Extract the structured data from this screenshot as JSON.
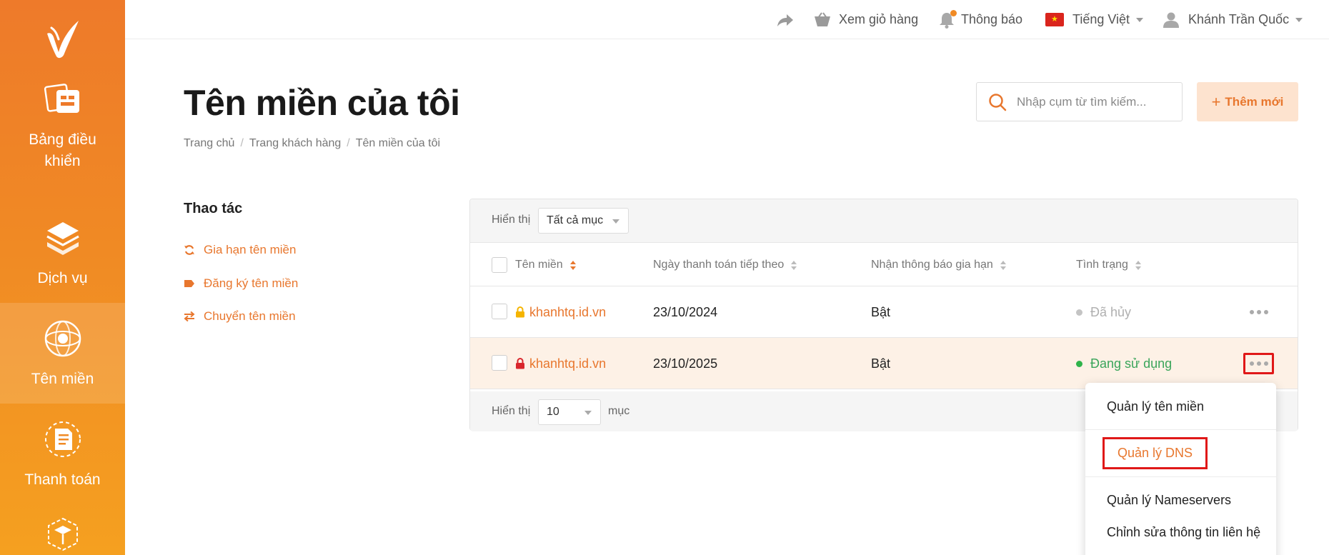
{
  "colors": {
    "brand": "#ee7a2a",
    "accent_link": "#e8772e",
    "active_status": "#3aa55a",
    "cancelled_status": "#b5b5b5",
    "highlight_box": "#e01818"
  },
  "sidebar": {
    "logo_icon": "check-logo-icon",
    "items": [
      {
        "label": "Bảng điều khiển",
        "icon": "dashboard-icon"
      },
      {
        "label": "Dịch vụ",
        "icon": "layers-icon"
      },
      {
        "label": "Tên miền",
        "icon": "globe-icon",
        "active": true
      },
      {
        "label": "Thanh toán",
        "icon": "invoice-icon"
      },
      {
        "label": "",
        "icon": "box-icon"
      }
    ]
  },
  "topbar": {
    "share_icon": "share-icon",
    "cart_label": "Xem giỏ hàng",
    "notify_label": "Thông báo",
    "language_label": "Tiếng Việt",
    "user_label": "Khánh Trần Quốc"
  },
  "page": {
    "title": "Tên miền của tôi",
    "breadcrumb": [
      "Trang chủ",
      "Trang khách hàng",
      "Tên miền của tôi"
    ],
    "search_placeholder": "Nhập cụm từ tìm kiếm...",
    "add_button_label": "Thêm mới"
  },
  "actions": {
    "title": "Thao tác",
    "items": [
      {
        "label": "Gia hạn tên miền",
        "icon": "refresh-icon"
      },
      {
        "label": "Đăng ký tên miền",
        "icon": "tag-icon"
      },
      {
        "label": "Chuyển tên miền",
        "icon": "transfer-icon"
      }
    ]
  },
  "table": {
    "filter_label": "Hiển thị",
    "filter_value": "Tất cả mục",
    "columns": [
      "Tên miền",
      "Ngày thanh toán tiếp theo",
      "Nhận thông báo gia hạn",
      "Tình trạng"
    ],
    "rows": [
      {
        "domain": "khanhtq.id.vn",
        "lock": "lock-yellow-icon",
        "next_payment": "23/10/2024",
        "renewal_notice": "Bật",
        "status": "Đã hủy"
      },
      {
        "domain": "khanhtq.id.vn",
        "lock": "lock-red-icon",
        "next_payment": "23/10/2025",
        "renewal_notice": "Bật",
        "status": "Đang sử dụng"
      }
    ],
    "footer_show_label": "Hiển thị",
    "page_size": "10",
    "footer_unit": "mục"
  },
  "dropdown": {
    "items": [
      "Quản lý tên miền",
      "Quản lý DNS",
      "Quản lý Nameservers",
      "Chỉnh sửa thông tin liên hệ"
    ]
  }
}
